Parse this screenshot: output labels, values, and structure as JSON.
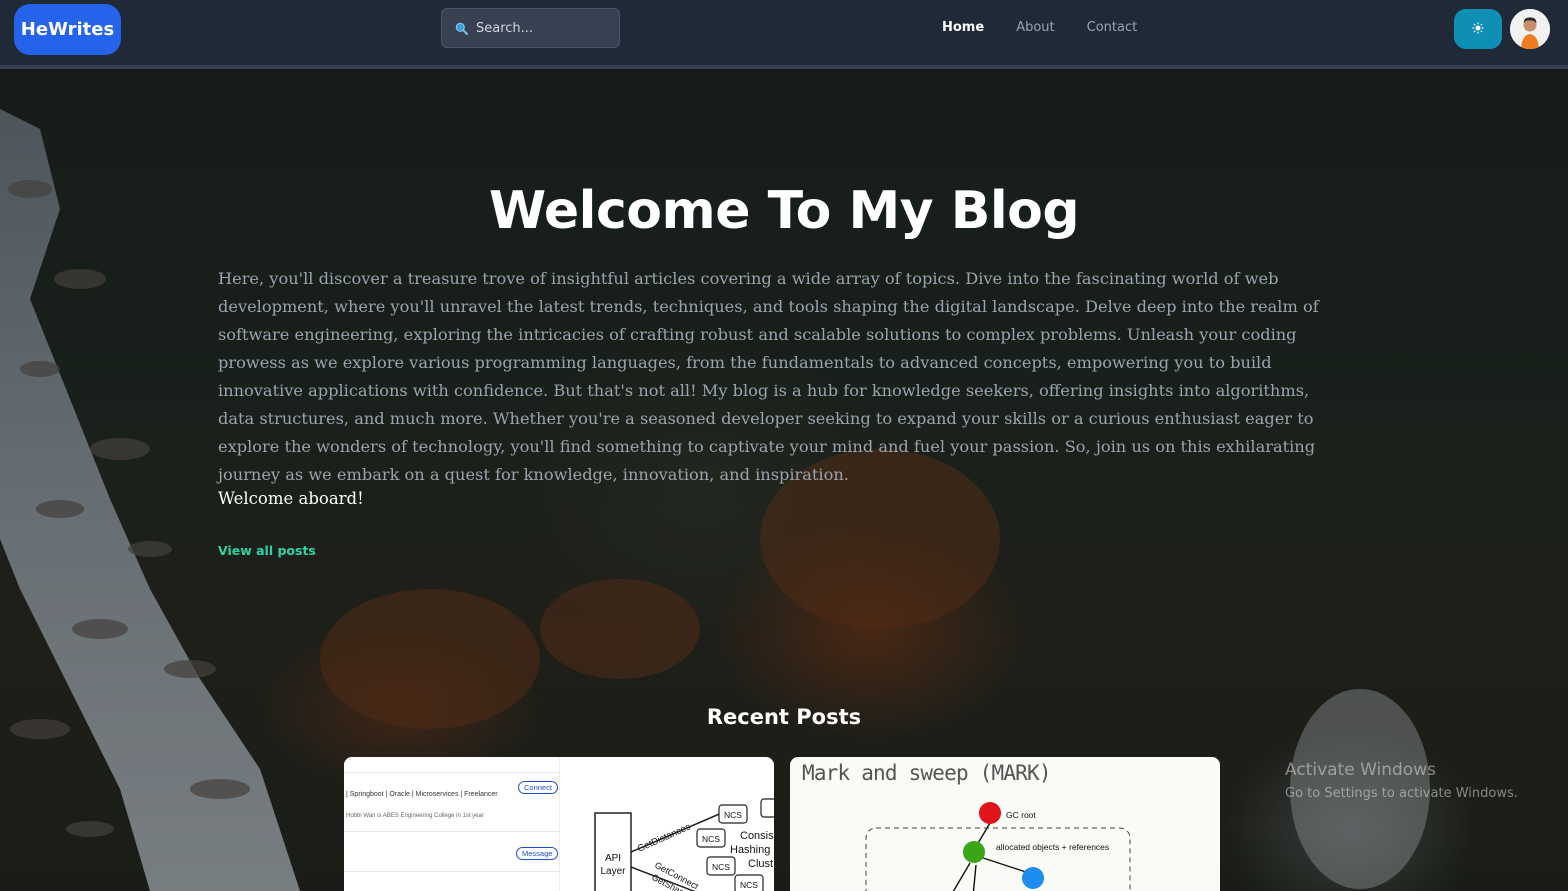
{
  "nav": {
    "logo": "HeWrites",
    "search_placeholder": "Search...",
    "links": [
      {
        "label": "Home",
        "active": true
      },
      {
        "label": "About",
        "active": false
      },
      {
        "label": "Contact",
        "active": false
      }
    ],
    "theme_icon": "sun-icon",
    "avatar_icon": "user-avatar"
  },
  "hero": {
    "title": "Welcome To My Blog",
    "description": "Here, you'll discover a treasure trove of insightful articles covering a wide array of topics. Dive into the fascinating world of web development, where you'll unravel the latest trends, techniques, and tools shaping the digital landscape. Delve deep into the realm of software engineering, exploring the intricacies of crafting robust and scalable solutions to complex problems. Unleash your coding prowess as we explore various programming languages, from the fundamentals to advanced concepts, empowering you to build innovative applications with confidence. But that's not all! My blog is a hub for knowledge seekers, offering insights into algorithms, data structures, and much more. Whether you're a seasoned developer seeking to expand your skills or a curious enthusiast eager to explore the wonders of technology, you'll find something to captivate your mind and fuel your passion. So, join us on this exhilarating journey as we embark on a quest for knowledge, innovation, and inspiration.",
    "welcome": "Welcome aboard!",
    "view_all": "View all posts"
  },
  "recent": {
    "title": "Recent Posts",
    "posts": [
      {
        "profile_line1": "| Springboot | Oracle | Microservices | Freelancer",
        "profile_line2": "Hobbi Wan is ABES Engineering College in 1st year",
        "connect": "Connect",
        "message": "Message",
        "diagram": {
          "api": "API",
          "layer": "Layer",
          "edge1": "GetDistances",
          "edge2": "GetConnect",
          "edge3": "GetShared",
          "node": "NCS",
          "consis": "Consis",
          "hashing": "Hashing",
          "clust": "Clust"
        }
      },
      {
        "title": "Mark and sweep (MARK)",
        "gc_root": "GC root",
        "allocated": "allocated objects + references"
      }
    ]
  },
  "watermark": {
    "line1": "Activate Windows",
    "line2": "Go to Settings to activate Windows."
  },
  "colors": {
    "logo_bg": "#2563eb",
    "nav_bg": "#1f2937",
    "theme_btn": "#0e8fb5",
    "link_accent": "#2dd4a3"
  }
}
